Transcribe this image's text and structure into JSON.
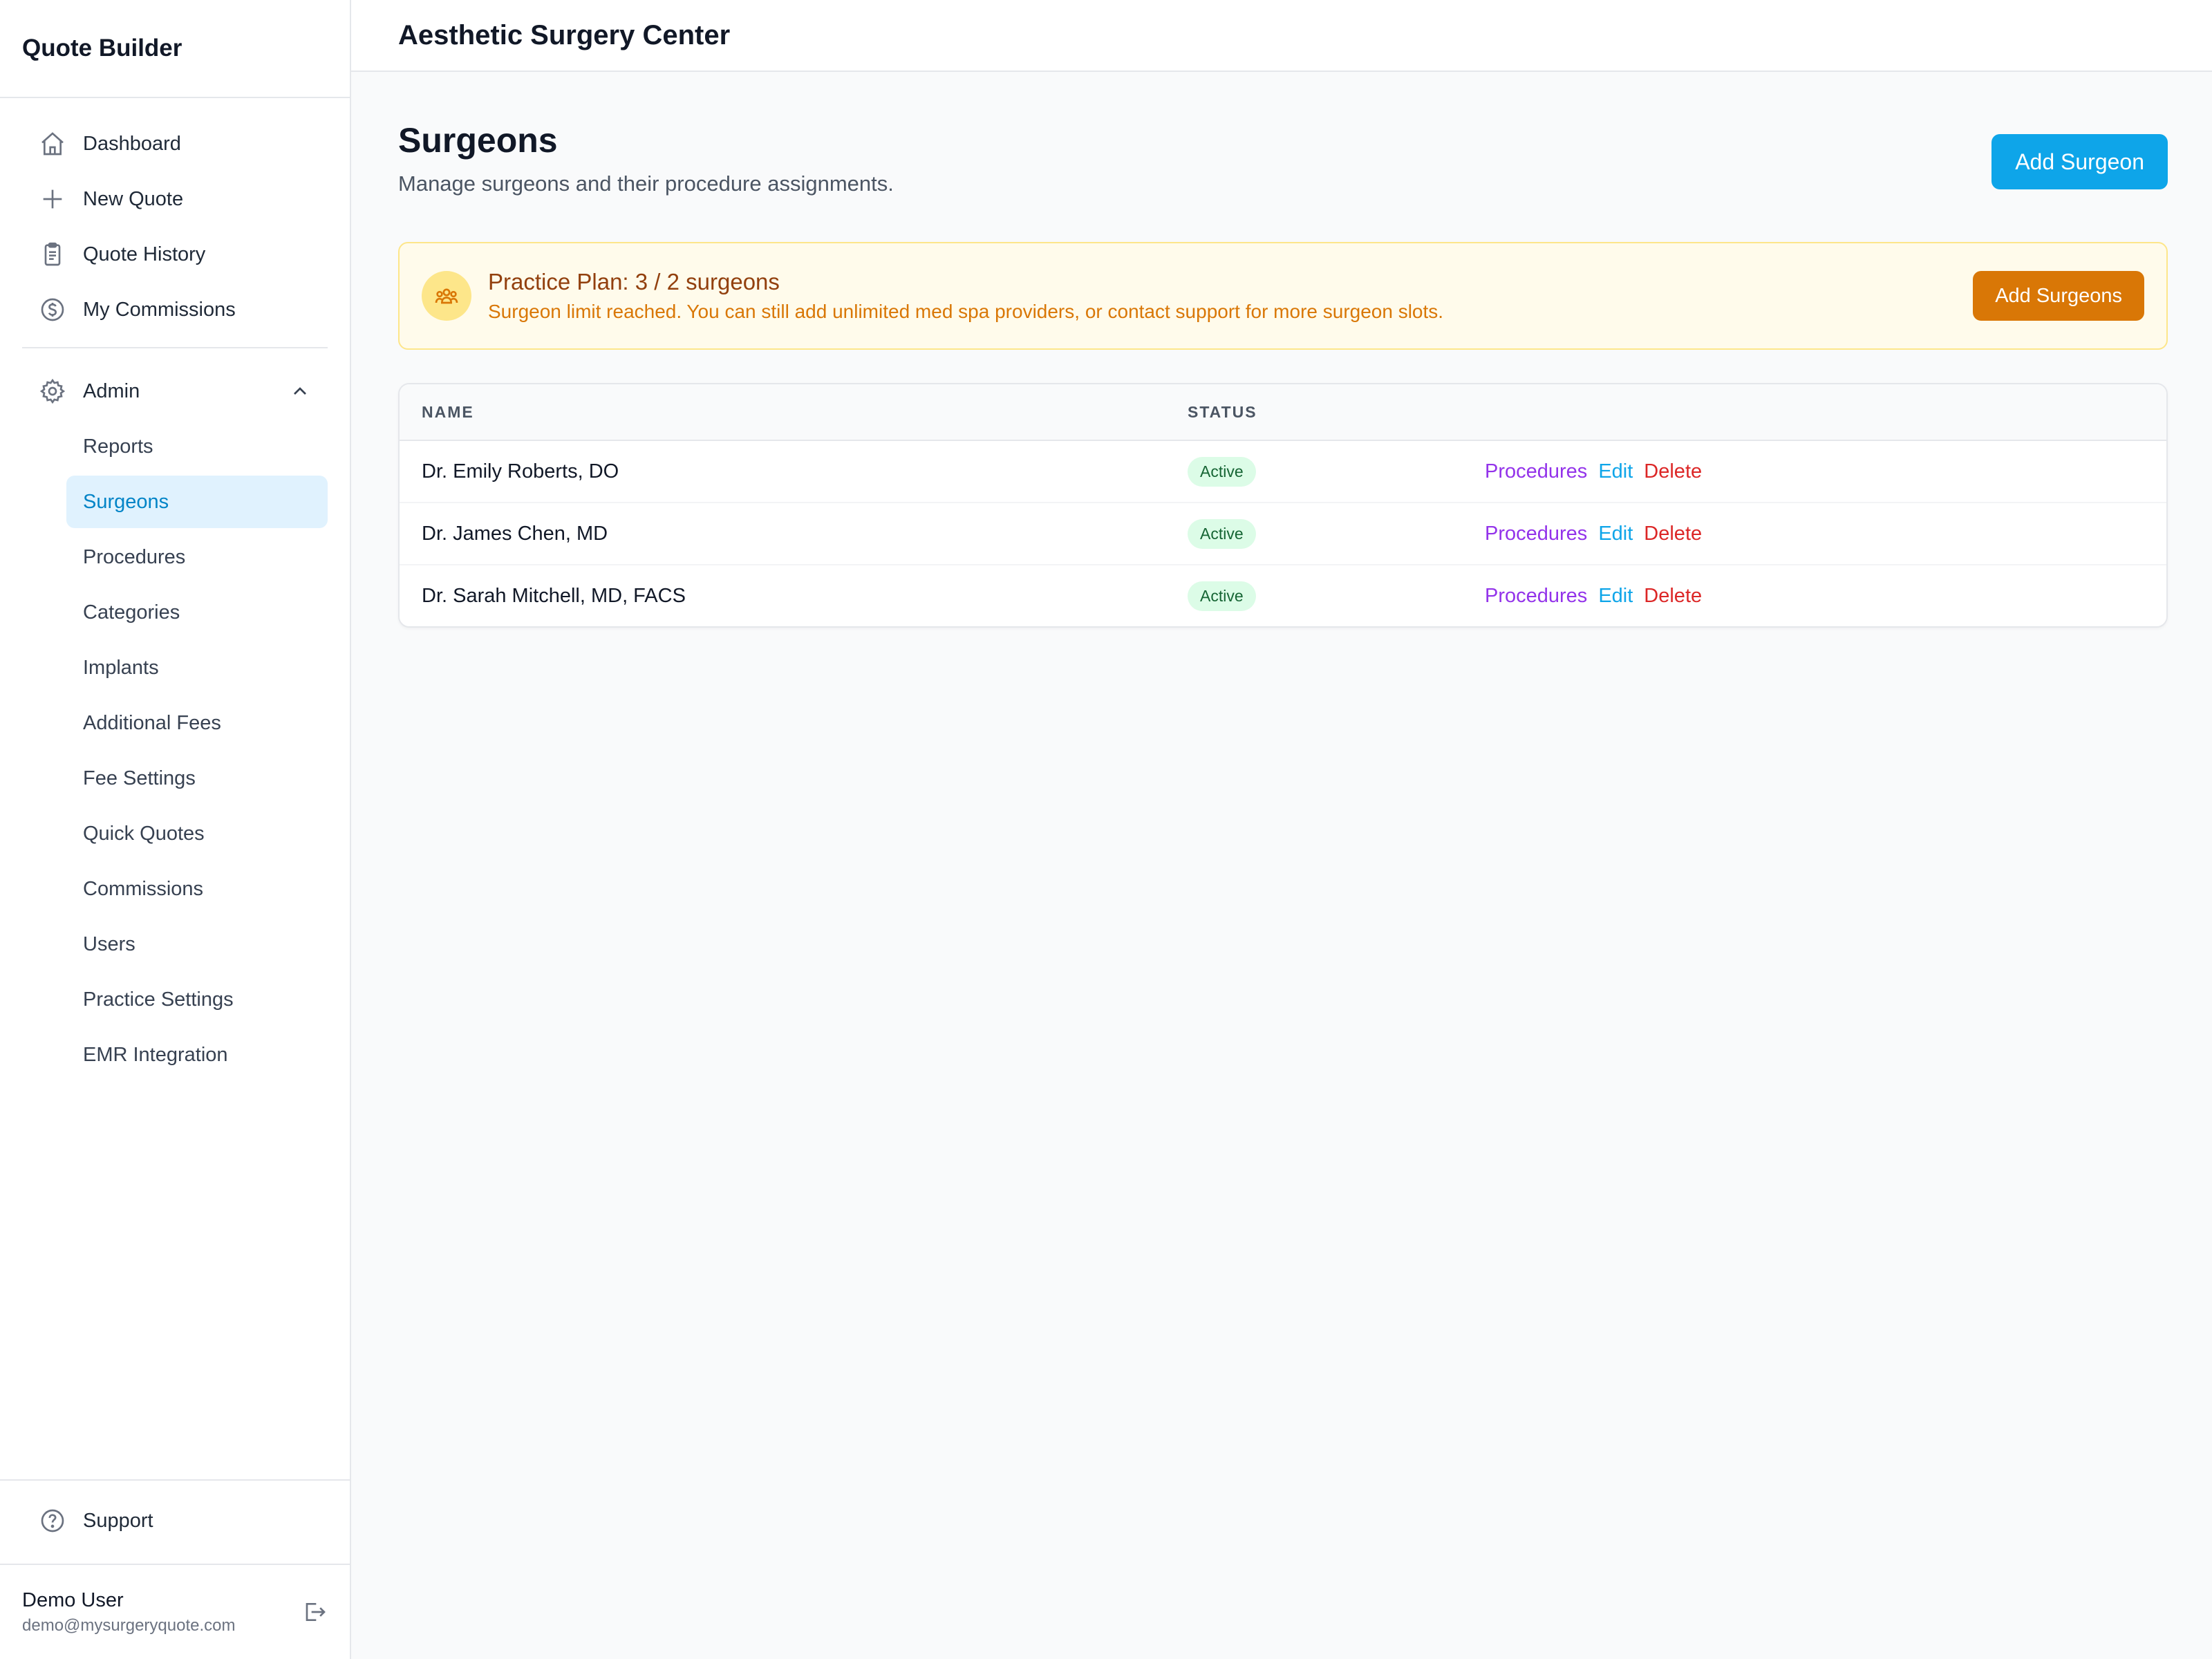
{
  "sidebar": {
    "brand": "Quote Builder",
    "main_items": [
      {
        "label": "Dashboard",
        "icon": "home-icon"
      },
      {
        "label": "New Quote",
        "icon": "plus-icon"
      },
      {
        "label": "Quote History",
        "icon": "clipboard-icon"
      },
      {
        "label": "My Commissions",
        "icon": "dollar-circle-icon"
      }
    ],
    "admin": {
      "label": "Admin",
      "icon": "gear-icon",
      "expanded": true,
      "items": [
        {
          "label": "Reports"
        },
        {
          "label": "Surgeons",
          "active": true
        },
        {
          "label": "Procedures"
        },
        {
          "label": "Categories"
        },
        {
          "label": "Implants"
        },
        {
          "label": "Additional Fees"
        },
        {
          "label": "Fee Settings"
        },
        {
          "label": "Quick Quotes"
        },
        {
          "label": "Commissions"
        },
        {
          "label": "Users"
        },
        {
          "label": "Practice Settings"
        },
        {
          "label": "EMR Integration"
        }
      ]
    },
    "support": {
      "label": "Support",
      "icon": "help-circle-icon"
    },
    "user": {
      "name": "Demo User",
      "email": "demo@mysurgeryquote.com"
    }
  },
  "header": {
    "practice_name": "Aesthetic Surgery Center"
  },
  "page": {
    "title": "Surgeons",
    "subtitle": "Manage surgeons and their procedure assignments.",
    "add_button": "Add Surgeon"
  },
  "banner": {
    "title": "Practice Plan: 3 / 2 surgeons",
    "message": "Surgeon limit reached. You can still add unlimited med spa providers, or contact support for more surgeon slots.",
    "button": "Add Surgeons",
    "icon": "users-group-icon"
  },
  "table": {
    "columns": [
      "NAME",
      "STATUS"
    ],
    "rows": [
      {
        "name": "Dr. Emily Roberts, DO",
        "status": "Active",
        "actions": [
          "Procedures",
          "Edit",
          "Delete"
        ]
      },
      {
        "name": "Dr. James Chen, MD",
        "status": "Active",
        "actions": [
          "Procedures",
          "Edit",
          "Delete"
        ]
      },
      {
        "name": "Dr. Sarah Mitchell, MD, FACS",
        "status": "Active",
        "actions": [
          "Procedures",
          "Edit",
          "Delete"
        ]
      }
    ]
  },
  "colors": {
    "primary": "#0ea5e9",
    "warning": "#d97706",
    "active_nav_bg": "#e0f2fe",
    "procedures_link": "#9333ea",
    "delete_link": "#dc2626",
    "status_active_bg": "#dcfce7"
  }
}
